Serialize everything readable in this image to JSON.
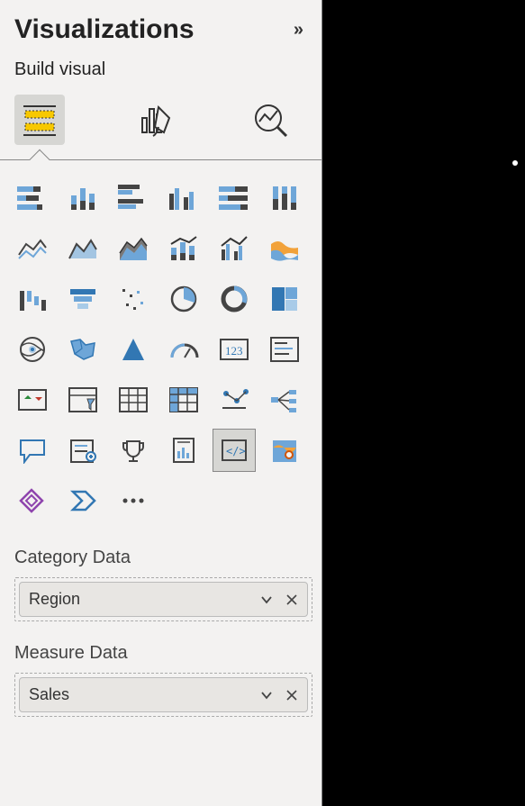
{
  "header": {
    "title": "Visualizations",
    "collapse_glyph": "»"
  },
  "sub_header": "Build visual",
  "tabs": {
    "build": "build",
    "format": "format",
    "analytics": "analytics"
  },
  "viz_icons": [
    "stacked-bar",
    "stacked-column",
    "clustered-bar",
    "clustered-column",
    "100-stacked-bar",
    "100-stacked-column",
    "line",
    "area",
    "stacked-area",
    "line-stacked-column",
    "line-clustered-column",
    "ribbon",
    "waterfall",
    "funnel",
    "scatter",
    "pie",
    "donut",
    "treemap",
    "map",
    "filled-map",
    "azure-map",
    "gauge",
    "card",
    "multi-row-card",
    "kpi",
    "slicer",
    "table",
    "matrix",
    "r-visual",
    "decomposition-tree",
    "qa",
    "narrative",
    "goals",
    "paginated",
    "python-visual",
    "arcgis",
    "power-apps",
    "power-automate",
    "ellipsis"
  ],
  "fields": {
    "category": {
      "label": "Category Data",
      "chip": "Region"
    },
    "measure": {
      "label": "Measure Data",
      "chip": "Sales"
    }
  }
}
